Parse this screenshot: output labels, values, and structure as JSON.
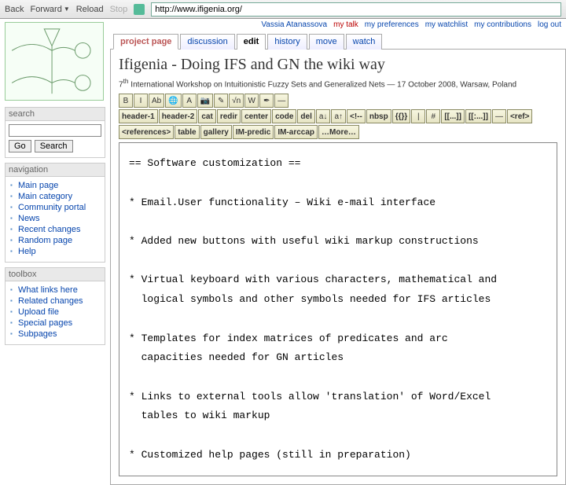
{
  "browser": {
    "back": "Back",
    "forward": "Forward",
    "reload": "Reload",
    "stop": "Stop",
    "url": "http://www.ifigenia.org/"
  },
  "userlinks": {
    "user": "Vassia Atanassova",
    "mytalk": "my talk",
    "prefs": "my preferences",
    "watchlist": "my watchlist",
    "contribs": "my contributions",
    "logout": "log out"
  },
  "tabs": {
    "project": "project page",
    "discussion": "discussion",
    "edit": "edit",
    "history": "history",
    "move": "move",
    "watch": "watch"
  },
  "page": {
    "title": "Ifigenia - Doing IFS and GN the wiki way",
    "subtitle_prefix": "7",
    "subtitle_sup": "th",
    "subtitle_rest": " International Workshop on Intuitionistic Fuzzy Sets and Generalized Nets — 17 October 2008, Warsaw, Poland"
  },
  "toolbar_row1": [
    "B",
    "I",
    "Ab",
    "🌐",
    "A",
    "📷",
    "✎",
    "√n",
    "W",
    "✒",
    "—"
  ],
  "toolbar_row2": [
    "header-1",
    "header-2",
    "cat",
    "redir",
    "center",
    "code",
    "del",
    "a↓",
    "a↑",
    "<!--",
    "nbsp",
    "{{}}",
    "|",
    "#",
    "[[...]]",
    "[[:...]]",
    "—",
    "<ref>"
  ],
  "toolbar_row3": [
    "<references>",
    "table",
    "gallery",
    "IM-predic",
    "IM-arccap",
    "…More…"
  ],
  "editor_text": "== Software customization ==\n\n* Email.User functionality – Wiki e-mail interface\n\n* Added new buttons with useful wiki markup constructions\n\n* Virtual keyboard with various characters, mathematical and\n  logical symbols and other symbols needed for IFS articles\n\n* Templates for index matrices of predicates and arc\n  capacities needed for GN articles\n\n* Links to external tools allow 'translation' of Word/Excel\n  tables to wiki markup\n\n* Customized help pages (still in preparation)",
  "search": {
    "title": "search",
    "go": "Go",
    "search_btn": "Search"
  },
  "navigation": {
    "title": "navigation",
    "items": [
      "Main page",
      "Main category",
      "Community portal",
      "News",
      "Recent changes",
      "Random page",
      "Help"
    ]
  },
  "toolbox": {
    "title": "toolbox",
    "items": [
      "What links here",
      "Related changes",
      "Upload file",
      "Special pages",
      "Subpages"
    ]
  }
}
